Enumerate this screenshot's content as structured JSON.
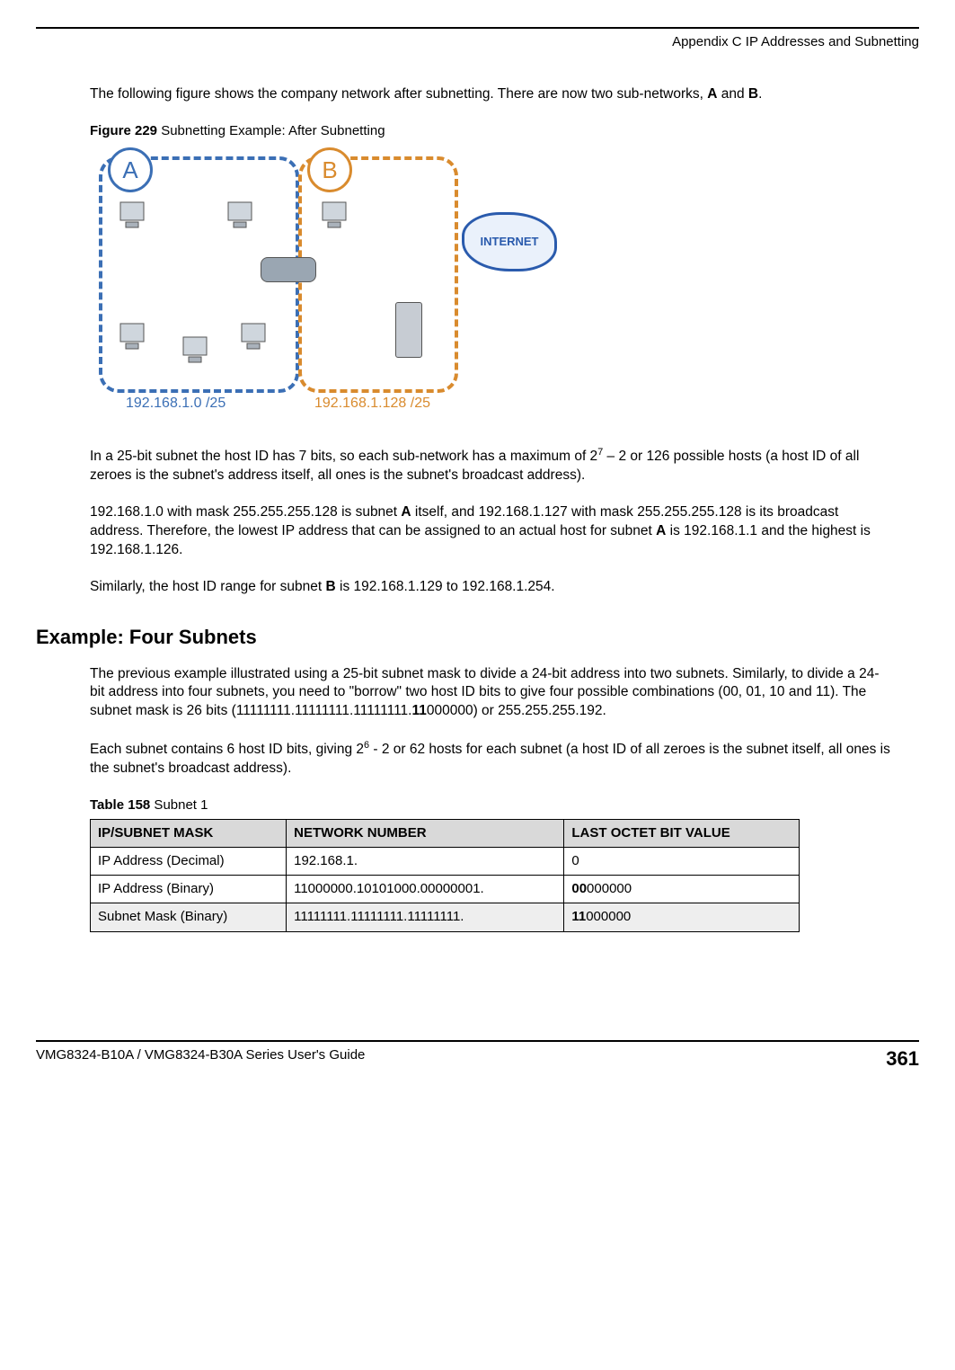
{
  "header": {
    "appendix_line": "Appendix C IP Addresses and Subnetting"
  },
  "intro": {
    "p1_a": "The following figure shows the company network after subnetting. There are now two sub-networks, ",
    "p1_bold_a": "A",
    "p1_mid": " and ",
    "p1_bold_b": "B",
    "p1_end": "."
  },
  "figure": {
    "caption_bold": "Figure 229",
    "caption_rest": "   Subnetting Example: After Subnetting",
    "subnet_a_label": "192.168.1.0 /25",
    "subnet_b_label": "192.168.1.128 /25",
    "internet_label": "INTERNET",
    "badge_a": "A",
    "badge_b": "B"
  },
  "body": {
    "p2_a": "In a 25-bit subnet the host ID has 7 bits, so each sub-network has a maximum of 2",
    "p2_sup": "7",
    "p2_b": " – 2 or 126 possible hosts (a host ID of all zeroes is the subnet's address itself, all ones is the subnet's broadcast address).",
    "p3_a": "192.168.1.0 with mask 255.255.255.128 is subnet ",
    "p3_boldA": "A",
    "p3_b": " itself, and 192.168.1.127 with mask 255.255.255.128 is its broadcast address. Therefore, the lowest IP address that can be assigned to an actual host for subnet ",
    "p3_boldA2": "A",
    "p3_c": " is 192.168.1.1 and the highest is 192.168.1.126.",
    "p4_a": "Similarly, the host ID range for subnet ",
    "p4_boldB": "B",
    "p4_b": " is 192.168.1.129 to 192.168.1.254."
  },
  "section": {
    "heading": "Example: Four Subnets",
    "p5": "The previous example illustrated using a 25-bit subnet mask to divide a 24-bit address into two subnets. Similarly, to divide a 24-bit address into four subnets, you need to \"borrow\" two host ID bits to give four possible combinations (00, 01, 10 and 11). The subnet mask is 26 bits (11111111.11111111.11111111.",
    "p5_bold11": "11",
    "p5_tail": "000000) or 255.255.255.192.",
    "p6_a": "Each subnet contains 6 host ID bits, giving 2",
    "p6_sup": "6",
    "p6_b": " - 2 or 62 hosts for each subnet (a host ID of all zeroes is the subnet itself, all ones is the subnet's broadcast address)."
  },
  "table": {
    "caption_bold": "Table 158",
    "caption_rest": "   Subnet 1",
    "headers": [
      "IP/SUBNET MASK",
      "NETWORK NUMBER",
      "LAST OCTET BIT VALUE"
    ],
    "rows": [
      {
        "c1": "IP Address (Decimal)",
        "c2": "192.168.1.",
        "c3": "0"
      },
      {
        "c1": "IP Address (Binary)",
        "c2": "11000000.10101000.00000001.",
        "c3_bold": "00",
        "c3_rest": "000000"
      },
      {
        "c1": "Subnet Mask (Binary)",
        "c2": "11111111.11111111.11111111.",
        "c3_bold": "11",
        "c3_rest": "000000",
        "shaded": true
      }
    ]
  },
  "footer": {
    "guide": "VMG8324-B10A / VMG8324-B30A Series User's Guide",
    "page": "361"
  }
}
